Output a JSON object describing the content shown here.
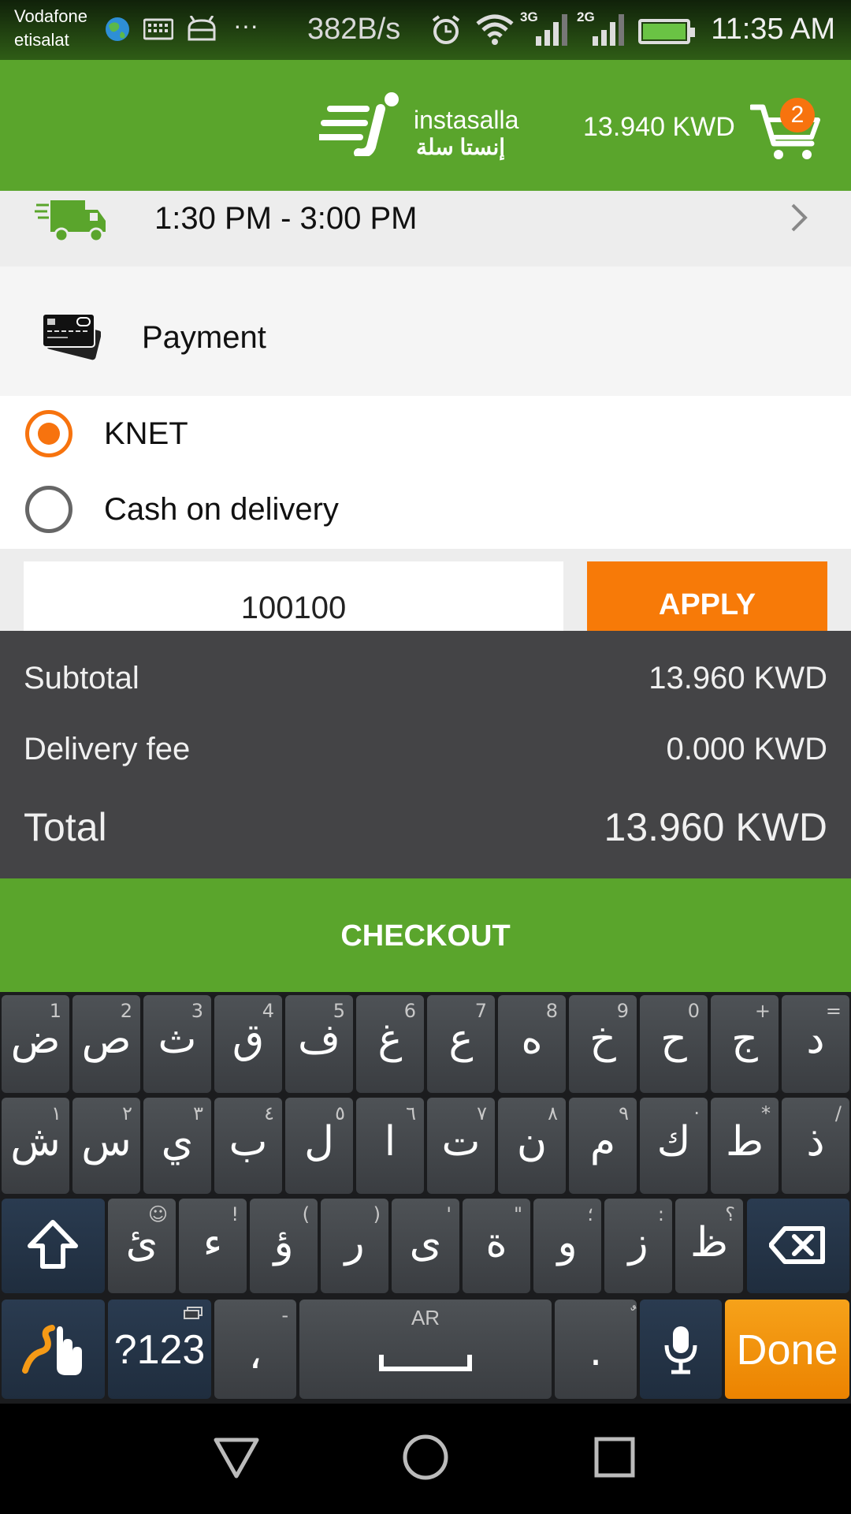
{
  "status_bar": {
    "carrier_1": "Vodafone",
    "carrier_2": "etisalat",
    "net_speed": "382B/s",
    "signal_1_label": "3G",
    "signal_2_label": "2G",
    "time": "11:35 AM"
  },
  "header": {
    "logo_en": "instasalla",
    "logo_ar": "إنستا سلة",
    "cart_total": "13.940 KWD",
    "cart_count": "2"
  },
  "delivery": {
    "time_slot": "1:30 PM - 3:00 PM"
  },
  "payment": {
    "title": "Payment",
    "options": [
      {
        "label": "KNET",
        "selected": true
      },
      {
        "label": "Cash on delivery",
        "selected": false
      }
    ]
  },
  "coupon": {
    "value": "100100",
    "apply_label": "APPLY"
  },
  "totals": {
    "subtotal_label": "Subtotal",
    "subtotal_value": "13.960 KWD",
    "delivery_label": "Delivery fee",
    "delivery_value": "0.000 KWD",
    "total_label": "Total",
    "total_value": "13.960 KWD"
  },
  "checkout_label": "CHECKOUT",
  "keyboard": {
    "row1": [
      {
        "main": "ض",
        "hint": "1"
      },
      {
        "main": "ص",
        "hint": "2"
      },
      {
        "main": "ث",
        "hint": "3"
      },
      {
        "main": "ق",
        "hint": "4"
      },
      {
        "main": "ف",
        "hint": "5"
      },
      {
        "main": "غ",
        "hint": "6"
      },
      {
        "main": "ع",
        "hint": "7"
      },
      {
        "main": "ه",
        "hint": "8"
      },
      {
        "main": "خ",
        "hint": "9"
      },
      {
        "main": "ح",
        "hint": "0"
      },
      {
        "main": "ج",
        "hint": "+"
      },
      {
        "main": "د",
        "hint": "="
      }
    ],
    "row2": [
      {
        "main": "ش",
        "hint": "١"
      },
      {
        "main": "س",
        "hint": "٢"
      },
      {
        "main": "ي",
        "hint": "٣"
      },
      {
        "main": "ب",
        "hint": "٤"
      },
      {
        "main": "ل",
        "hint": "٥"
      },
      {
        "main": "ا",
        "hint": "٦"
      },
      {
        "main": "ت",
        "hint": "٧"
      },
      {
        "main": "ن",
        "hint": "٨"
      },
      {
        "main": "م",
        "hint": "٩"
      },
      {
        "main": "ك",
        "hint": "·"
      },
      {
        "main": "ط",
        "hint": "*"
      },
      {
        "main": "ذ",
        "hint": "/"
      }
    ],
    "row3": [
      {
        "main": "ئ",
        "hint": "☺"
      },
      {
        "main": "ء",
        "hint": "!"
      },
      {
        "main": "ؤ",
        "hint": "("
      },
      {
        "main": "ر",
        "hint": ")"
      },
      {
        "main": "ى",
        "hint": "'"
      },
      {
        "main": "ة",
        "hint": "\""
      },
      {
        "main": "و",
        "hint": "؛"
      },
      {
        "main": "ز",
        "hint": ":"
      },
      {
        "main": "ظ",
        "hint": "؟"
      }
    ],
    "symbols_label": "?123",
    "comma": "،",
    "comma_hint": "-",
    "space_hint": "AR",
    "period": ".",
    "period_hint": "ٌ",
    "done_label": "Done"
  }
}
